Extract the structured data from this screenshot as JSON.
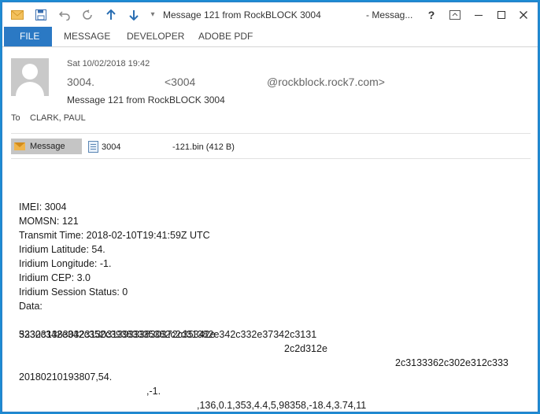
{
  "titlebar": {
    "title": "Message 121 from RockBLOCK 3004",
    "app": "- Messag...",
    "help": "?",
    "icons": [
      "mail-icon",
      "save-icon",
      "undo-icon",
      "redo-icon",
      "up-arrow-icon",
      "down-arrow-icon",
      "customize-icon"
    ]
  },
  "ribbon": {
    "tabs": [
      "FILE",
      "MESSAGE",
      "DEVELOPER",
      "ADOBE PDF"
    ]
  },
  "header": {
    "date": "Sat 10/02/2018 19:42",
    "sender_name": "3004.",
    "sender_email_start": "<3004",
    "sender_email_end": "@rockblock.rock7.com>",
    "subject": "Message 121 from RockBLOCK 3004",
    "to_label": "To",
    "to_value": "CLARK, PAUL"
  },
  "attachments": {
    "message_label": "Message",
    "file_name_start": "3004",
    "file_name_end": "-121.bin (412 B)"
  },
  "body": {
    "lines": [
      "IMEI: 3004",
      "MOMSN: 121",
      "Transmit Time: 2018-02-10T19:41:59Z UTC",
      "Iridium Latitude: 54.",
      "Iridium Longitude: -1.",
      "Iridium CEP: 3.0",
      "Iridium Session Status: 0",
      "Data:",
      "3230313830323130313933383037 2c35342e",
      "5332c342e342c352c39383335382c2d31382e342c332e37342c3131"
    ],
    "data_part1": "32303138303231303139333830372c35342e",
    "data_part2": "2c2d312e",
    "data_part3": "2c3133362c302e312c333",
    "data_line2": "5332c342e342c352c39383335382c2d31382e342c332e37342c3131",
    "decoded_part1": "20180210193807,54.",
    "decoded_part2": ",-1.",
    "decoded_part3": ",136,0.1,353,4.4,5,98358,-18.4,3.74,11"
  }
}
